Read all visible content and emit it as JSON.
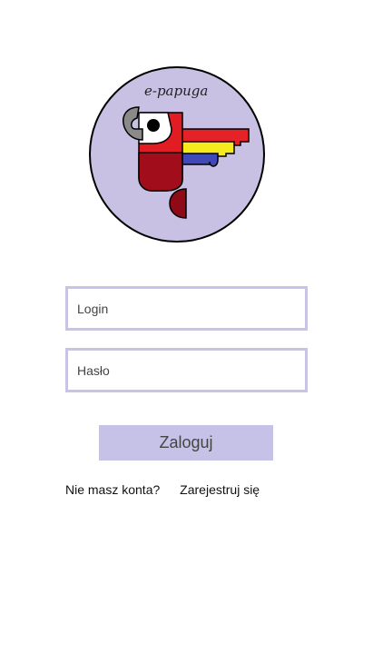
{
  "app": {
    "logo_text": "e-papuga"
  },
  "form": {
    "login_placeholder": "Login",
    "password_placeholder": "Hasło",
    "submit_label": "Zaloguj"
  },
  "register": {
    "question": "Nie masz konta?",
    "link_label": "Zarejestruj się"
  },
  "colors": {
    "accent": "#c6c1e6",
    "field_border": "#c9c3e6",
    "logo_background": "#c9c1e4"
  }
}
